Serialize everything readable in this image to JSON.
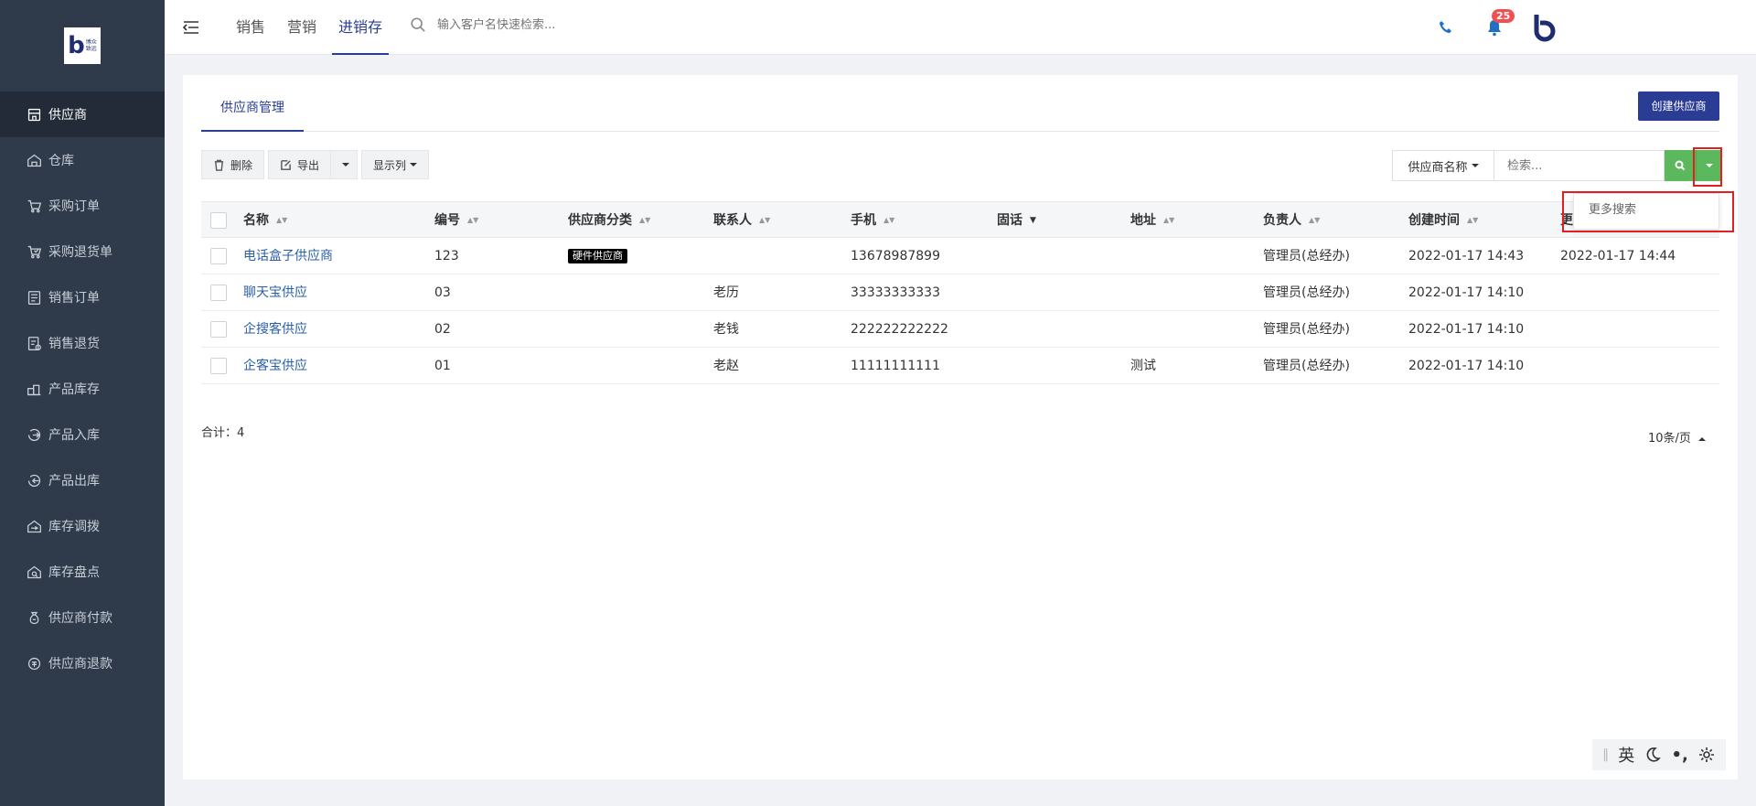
{
  "logo": {
    "mark": "b",
    "line1": "博众",
    "line2": "致远"
  },
  "sidebar": {
    "items": [
      {
        "label": "供应商",
        "icon": "store-icon",
        "active": true
      },
      {
        "label": "仓库",
        "icon": "warehouse-icon"
      },
      {
        "label": "采购订单",
        "icon": "cart-icon"
      },
      {
        "label": "采购退货单",
        "icon": "cart-return-icon"
      },
      {
        "label": "销售订单",
        "icon": "order-list-icon"
      },
      {
        "label": "销售退货",
        "icon": "return-doc-icon"
      },
      {
        "label": "产品库存",
        "icon": "inventory-icon"
      },
      {
        "label": "产品入库",
        "icon": "stock-in-icon"
      },
      {
        "label": "产品出库",
        "icon": "stock-out-icon"
      },
      {
        "label": "库存调拨",
        "icon": "transfer-icon"
      },
      {
        "label": "库存盘点",
        "icon": "stocktake-icon"
      },
      {
        "label": "供应商付款",
        "icon": "payment-bag-icon"
      },
      {
        "label": "供应商退款",
        "icon": "refund-icon"
      }
    ]
  },
  "header": {
    "tabs": [
      "销售",
      "营销",
      "进销存"
    ],
    "active_tab": "进销存",
    "search_placeholder": "输入客户名快速检索...",
    "notification_count": "25"
  },
  "page": {
    "tab": "供应商管理",
    "create_button": "创建供应商"
  },
  "toolbar": {
    "delete": "删除",
    "export": "导出",
    "columns": "显示列"
  },
  "search": {
    "field": "供应商名称",
    "placeholder": "检索...",
    "more": "更多搜索"
  },
  "table": {
    "headers": [
      "名称",
      "编号",
      "供应商分类",
      "联系人",
      "手机",
      "固话",
      "地址",
      "负责人",
      "创建时间",
      "更"
    ],
    "rows": [
      {
        "name": "电话盒子供应商",
        "code": "123",
        "category": "硬件供应商",
        "contact": "",
        "mobile": "13678987899",
        "tel": "",
        "address": "",
        "owner": "管理员(总经办)",
        "created": "2022-01-17 14:43",
        "updated": "2022-01-17 14:44"
      },
      {
        "name": "聊天宝供应",
        "code": "03",
        "category": "",
        "contact": "老历",
        "mobile": "33333333333",
        "tel": "",
        "address": "",
        "owner": "管理员(总经办)",
        "created": "2022-01-17 14:10",
        "updated": ""
      },
      {
        "name": "企搜客供应",
        "code": "02",
        "category": "",
        "contact": "老钱",
        "mobile": "222222222222",
        "tel": "",
        "address": "",
        "owner": "管理员(总经办)",
        "created": "2022-01-17 14:10",
        "updated": ""
      },
      {
        "name": "企客宝供应",
        "code": "01",
        "category": "",
        "contact": "老赵",
        "mobile": "11111111111",
        "tel": "",
        "address": "测试",
        "owner": "管理员(总经办)",
        "created": "2022-01-17 14:10",
        "updated": ""
      }
    ]
  },
  "footer": {
    "total": "合计：4",
    "page_size": "10条/页"
  },
  "ime": {
    "lang": "英"
  },
  "colors": {
    "sidebar_bg": "#2f3a4a",
    "primary": "#2a3c94",
    "search_green": "#5cb85c",
    "highlight_red": "#e02020",
    "link": "#2a5fa8"
  }
}
